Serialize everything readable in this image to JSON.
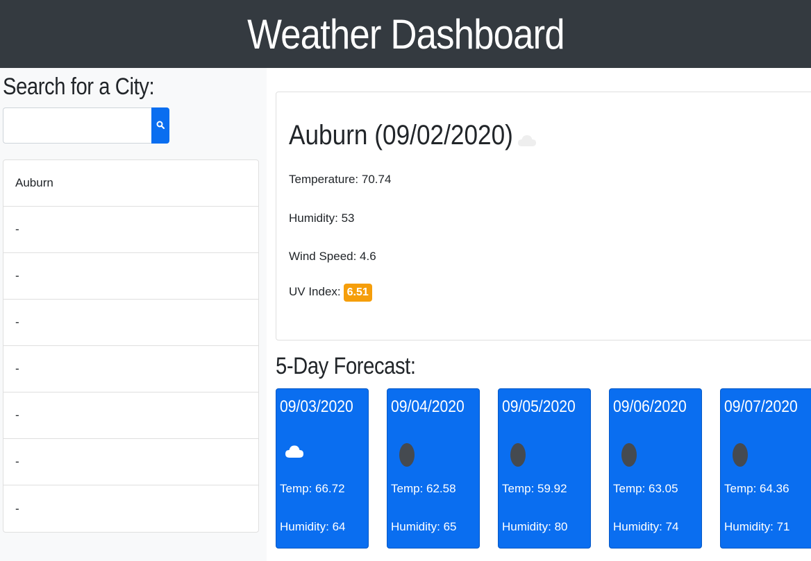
{
  "header": {
    "title": "Weather Dashboard"
  },
  "sidebar": {
    "title": "Search for a City:",
    "search": {
      "value": "",
      "placeholder": ""
    },
    "search_icon": "search-icon",
    "cities": [
      "Auburn",
      "-",
      "-",
      "-",
      "-",
      "-",
      "-",
      "-"
    ]
  },
  "current": {
    "title": "Auburn (09/02/2020)",
    "icon": "cloud-icon",
    "temperature": "Temperature: 70.74",
    "humidity": "Humidity: 53",
    "wind": "Wind Speed: 4.6",
    "uv_label": "UV Index:",
    "uv_value": "6.51",
    "uv_color": "#f59e0b"
  },
  "forecast": {
    "title": "5-Day Forecast:",
    "days": [
      {
        "date": "09/03/2020",
        "icon": "cloud-icon",
        "temp": "Temp: 66.72",
        "humidity": "Humidity: 64"
      },
      {
        "date": "09/04/2020",
        "icon": "moon-icon",
        "temp": "Temp: 62.58",
        "humidity": "Humidity: 65"
      },
      {
        "date": "09/05/2020",
        "icon": "moon-icon",
        "temp": "Temp: 59.92",
        "humidity": "Humidity: 80"
      },
      {
        "date": "09/06/2020",
        "icon": "moon-icon",
        "temp": "Temp: 63.05",
        "humidity": "Humidity: 74"
      },
      {
        "date": "09/07/2020",
        "icon": "moon-icon",
        "temp": "Temp: 64.36",
        "humidity": "Humidity: 71"
      }
    ]
  },
  "colors": {
    "header_bg": "#343a40",
    "accent": "#0a6ef0",
    "uv_moderate": "#f59e0b"
  }
}
